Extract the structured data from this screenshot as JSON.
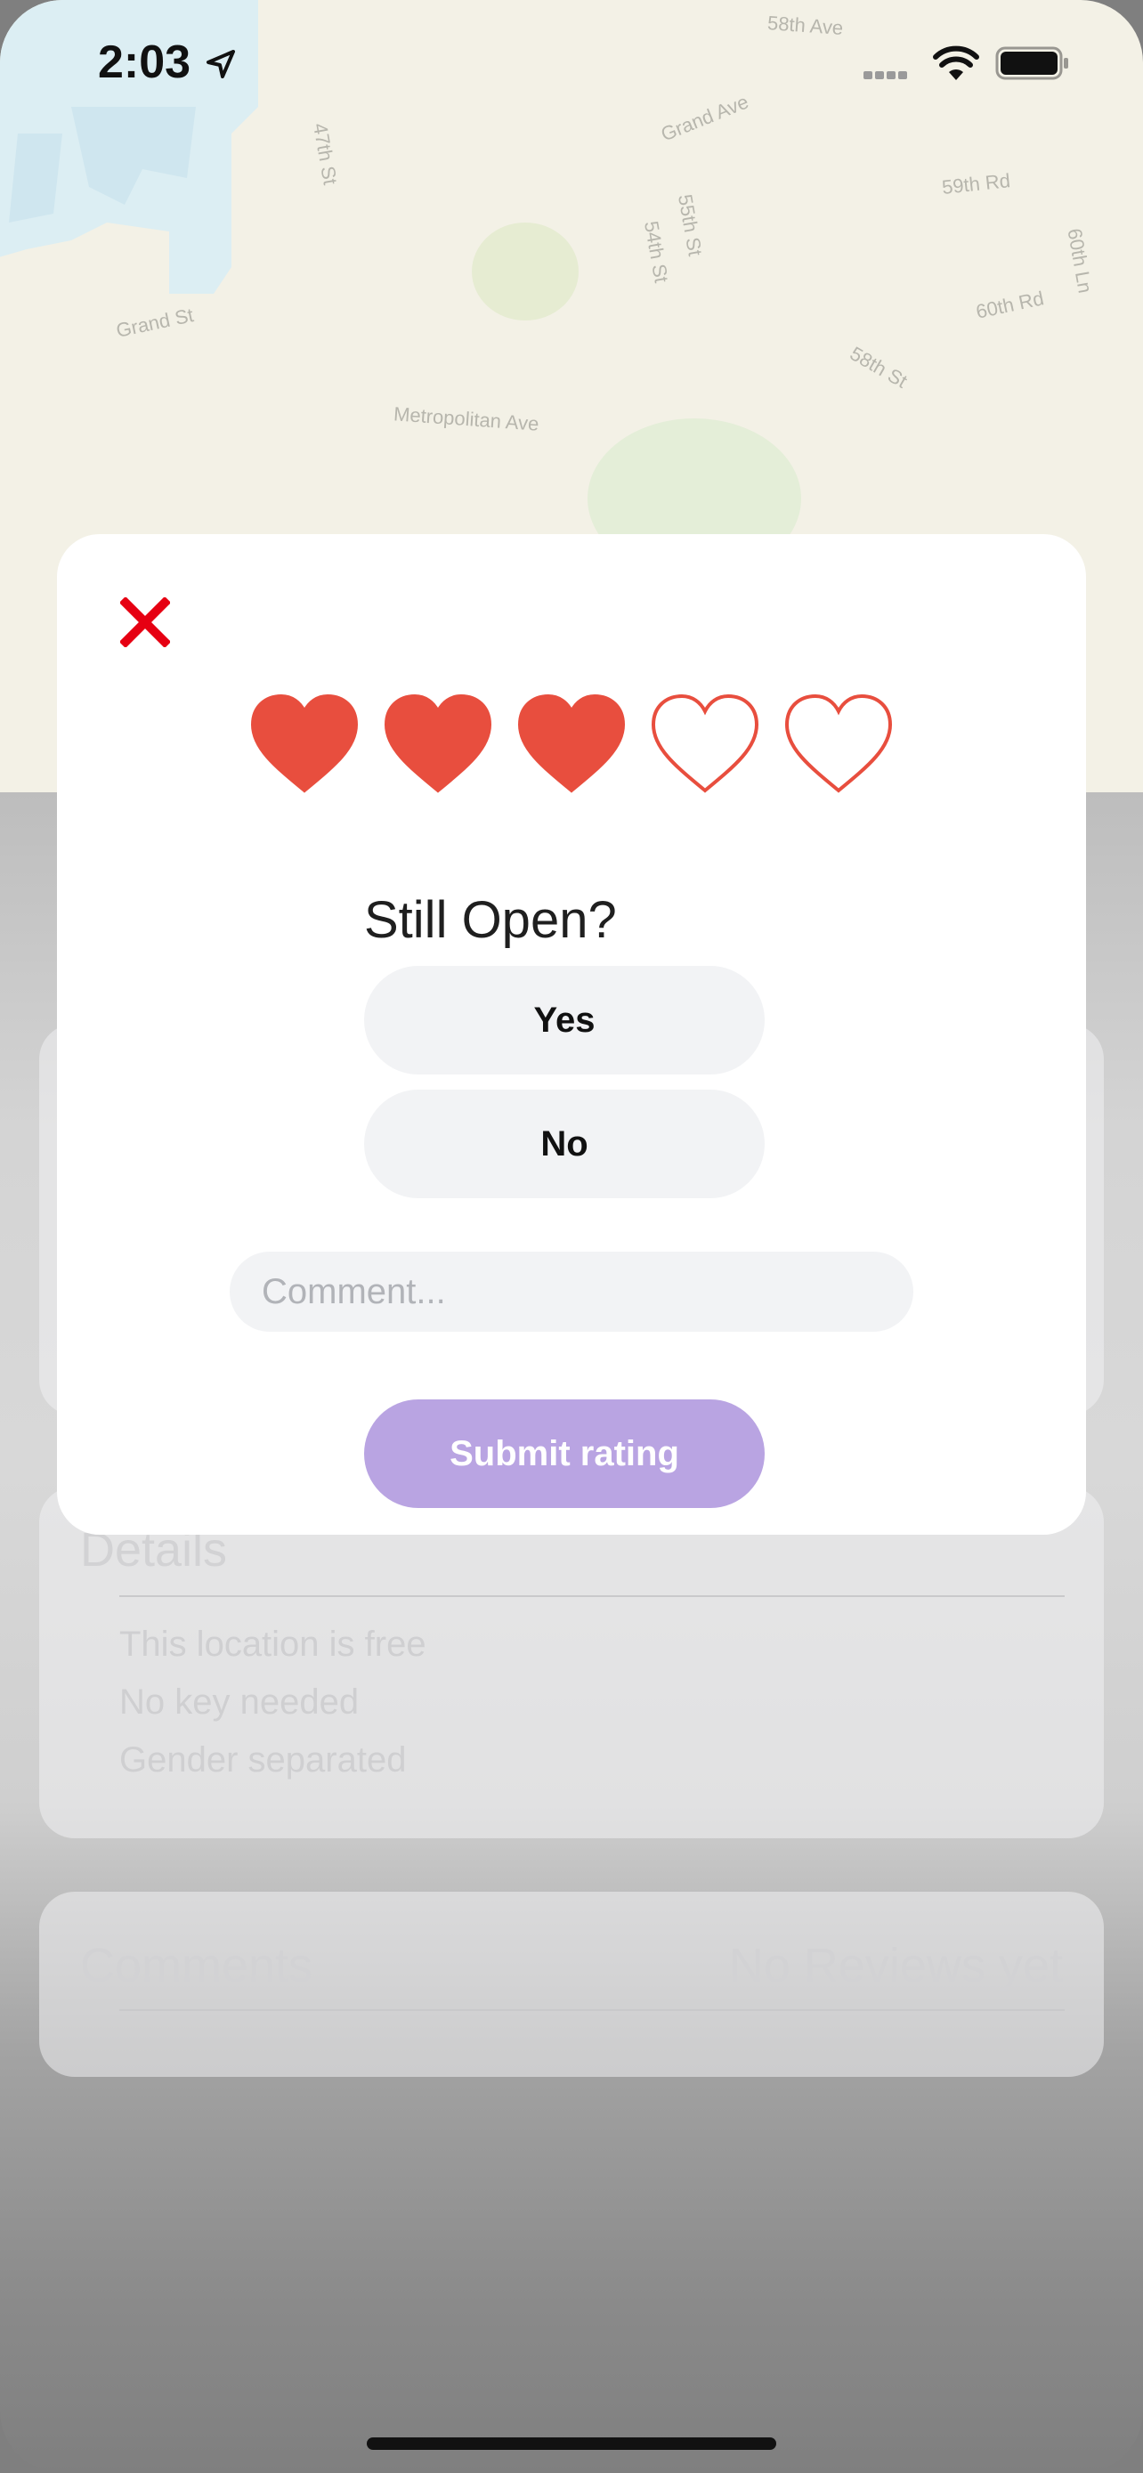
{
  "status_bar": {
    "time": "2:03"
  },
  "map": {
    "streets": [
      "58th Ave",
      "47th St",
      "Grand Ave",
      "59th Rd",
      "55th St",
      "54th St",
      "Grand St",
      "60th Rd",
      "60th Ln",
      "58th St",
      "Metropolitan Ave"
    ]
  },
  "rating_modal": {
    "rating": 3,
    "max_rating": 5,
    "question": "Still Open?",
    "yes_label": "Yes",
    "no_label": "No",
    "comment_placeholder": "Comment...",
    "comment_value": "",
    "submit_label": "Submit rating",
    "colors": {
      "heart": "#e84e3e",
      "close": "#e60012",
      "submit": "#b9a4e2"
    }
  },
  "background": {
    "details": {
      "title": "Details",
      "lines": [
        "This location is free",
        "No key needed",
        "Gender separated"
      ]
    },
    "comments": {
      "title": "Comments",
      "status": "No Reviews yet"
    }
  }
}
